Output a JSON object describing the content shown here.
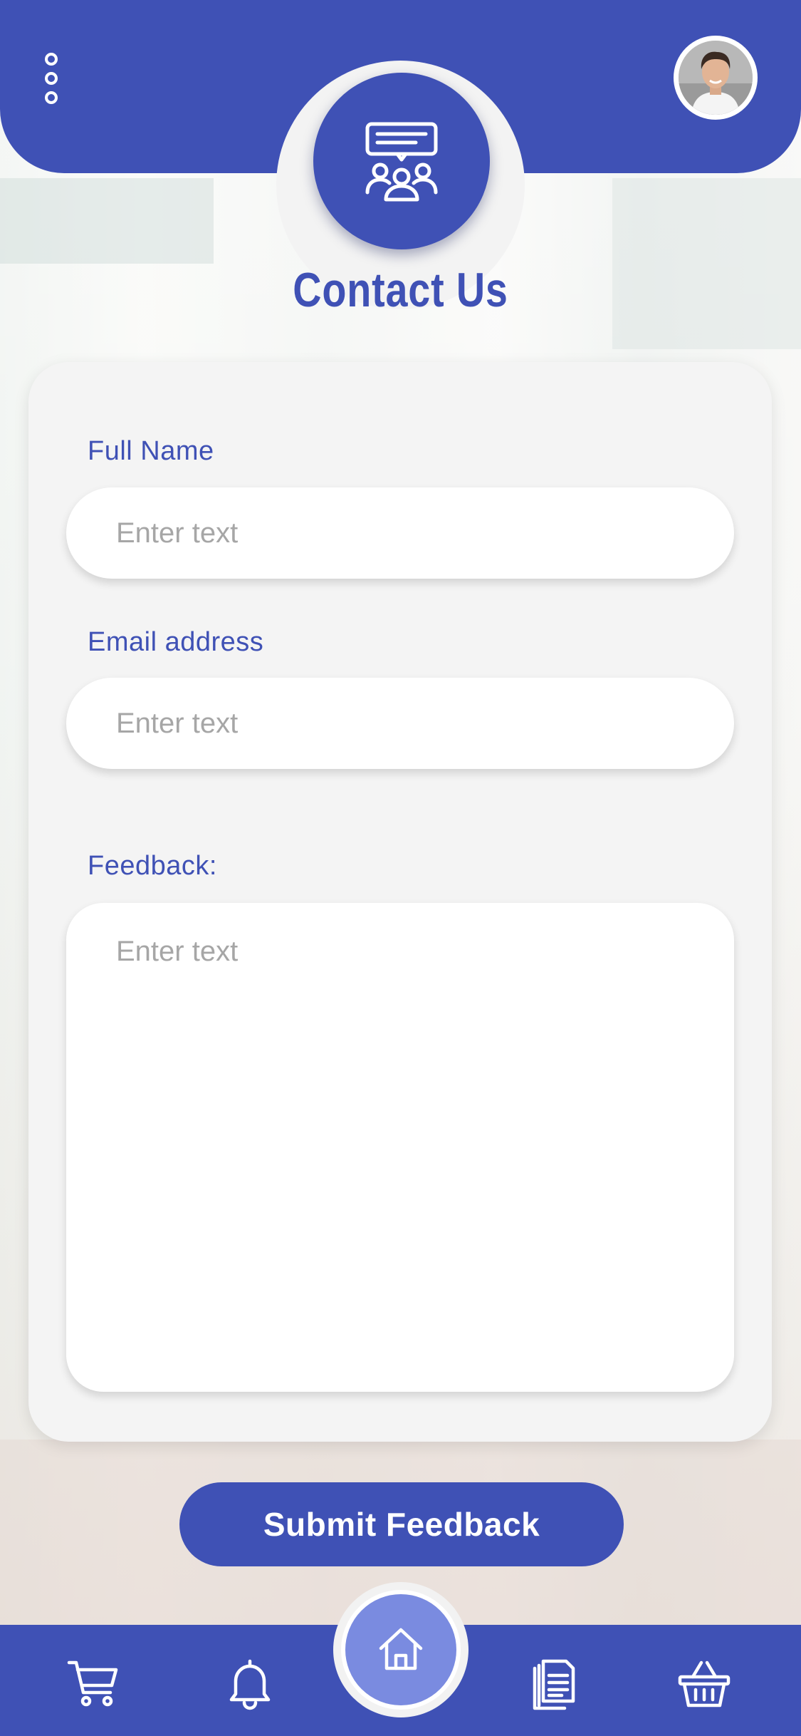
{
  "header": {
    "menu_icon": "more-vertical-icon",
    "avatar_icon": "user-avatar",
    "badge_icon": "group-chat-icon",
    "title": "Contact Us"
  },
  "form": {
    "full_name": {
      "label": "Full Name",
      "placeholder": "Enter text",
      "value": ""
    },
    "email": {
      "label": "Email address",
      "placeholder": "Enter text",
      "value": ""
    },
    "feedback": {
      "label": "Feedback:",
      "placeholder": "Enter text",
      "value": ""
    },
    "submit_label": "Submit Feedback"
  },
  "bottom_nav": {
    "items": [
      {
        "icon": "cart-icon"
      },
      {
        "icon": "bell-icon"
      },
      {
        "icon": "home-icon",
        "active": true
      },
      {
        "icon": "documents-icon"
      },
      {
        "icon": "basket-icon"
      }
    ]
  },
  "colors": {
    "primary": "#3f51b5",
    "home_button": "#7a8be0",
    "card": "#f4f4f4",
    "placeholder": "#a6a6a6"
  }
}
